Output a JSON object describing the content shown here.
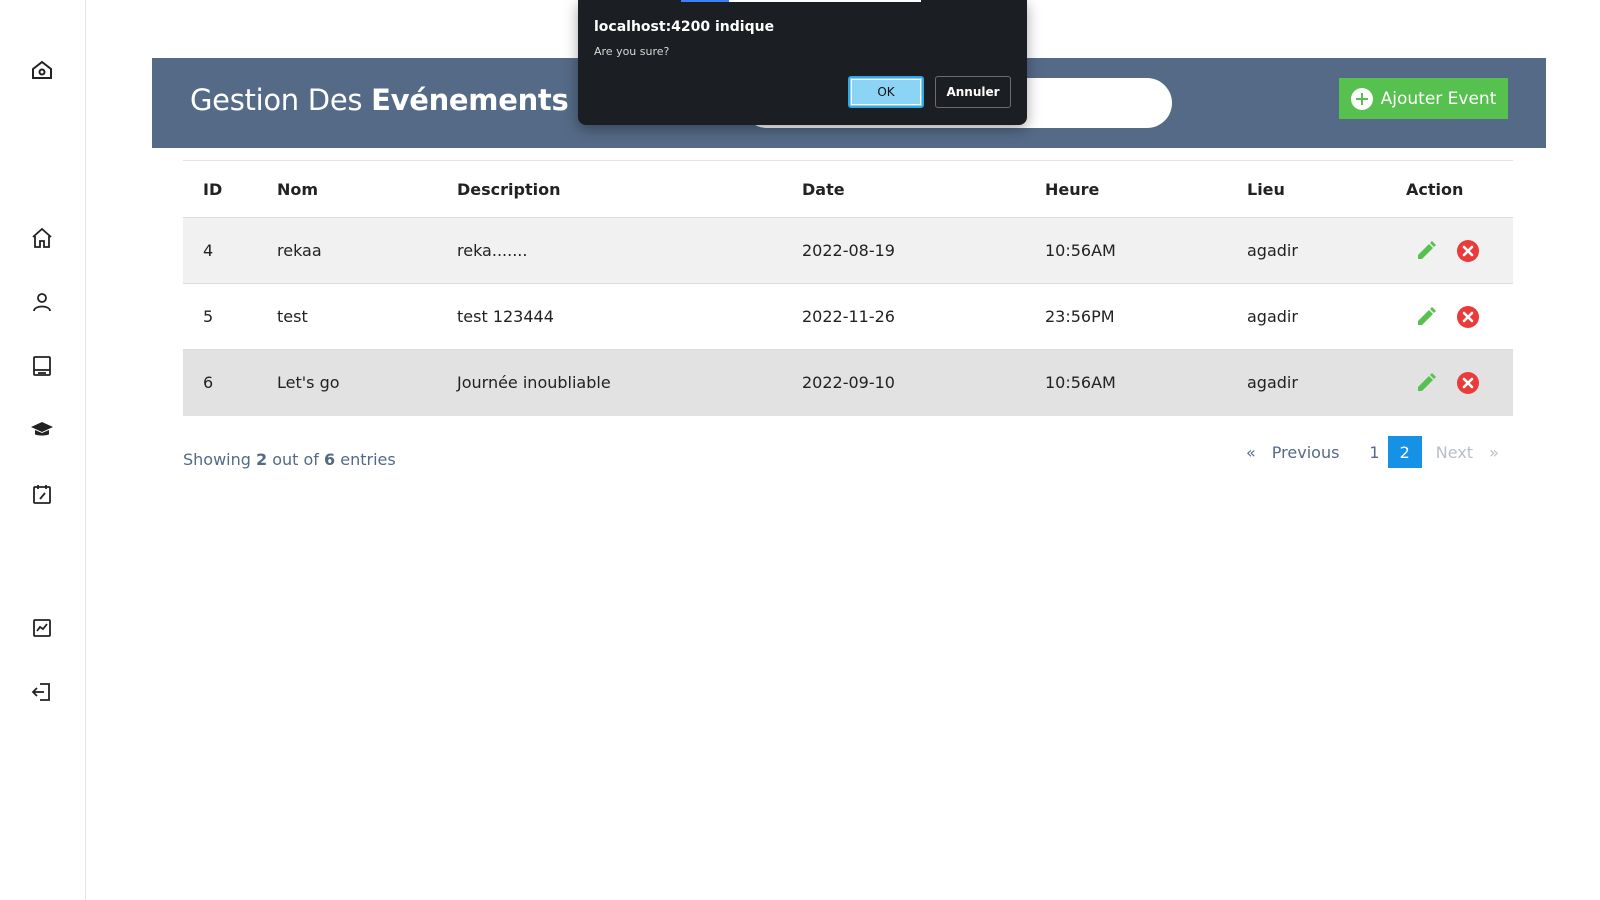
{
  "sidebar": {
    "items": [
      {
        "name": "logo",
        "icon": "house-gear-icon"
      },
      {
        "name": "home",
        "icon": "home-icon"
      },
      {
        "name": "users",
        "icon": "user-icon"
      },
      {
        "name": "books",
        "icon": "book-icon"
      },
      {
        "name": "courses",
        "icon": "graduation-cap-icon"
      },
      {
        "name": "events",
        "icon": "calendar-icon"
      },
      {
        "name": "stats",
        "icon": "chart-icon"
      },
      {
        "name": "logout",
        "icon": "logout-icon"
      }
    ]
  },
  "header": {
    "title_part1": "Gestion Des ",
    "title_part2": "Evénements",
    "search_value": "",
    "add_button_label": "Ajouter Event",
    "banner_color": "#546a87",
    "add_button_color": "#57c14f"
  },
  "table": {
    "columns": [
      "ID",
      "Nom",
      "Description",
      "Date",
      "Heure",
      "Lieu",
      "Action"
    ],
    "rows": [
      {
        "id": "4",
        "nom": "rekaa",
        "description": "reka.......",
        "date": "2022-08-19",
        "heure": "10:56AM",
        "lieu": "agadir"
      },
      {
        "id": "5",
        "nom": "test",
        "description": "test 123444",
        "date": "2022-11-26",
        "heure": "23:56PM",
        "lieu": "agadir"
      },
      {
        "id": "6",
        "nom": "Let's go",
        "description": "Journée inoubliable",
        "date": "2022-09-10",
        "heure": "10:56AM",
        "lieu": "agadir"
      }
    ]
  },
  "footer": {
    "showing_prefix": "Showing ",
    "showing_count": "2",
    "showing_middle": " out of ",
    "showing_total": "6",
    "showing_suffix": " entries"
  },
  "pagination": {
    "prev_arrow": "«",
    "previous": "Previous",
    "page1": "1",
    "page2": "2",
    "next": "Next",
    "next_arrow": "»",
    "active_color": "#1591e6"
  },
  "dialog": {
    "title": "localhost:4200 indique",
    "message": "Are you sure?",
    "ok_label": "OK",
    "cancel_label": "Annuler"
  }
}
